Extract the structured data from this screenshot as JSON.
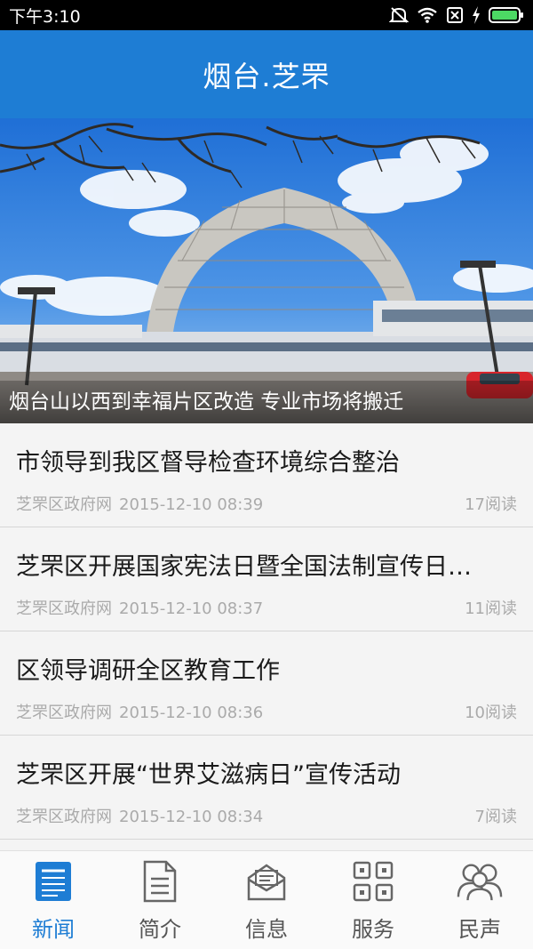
{
  "status_bar": {
    "time": "下午3:10",
    "icons": [
      "mute-icon",
      "wifi-icon",
      "sim-off-icon",
      "charging-icon",
      "battery-icon"
    ]
  },
  "header": {
    "title": "烟台.芝罘"
  },
  "hero": {
    "caption": "烟台山以西到幸福片区改造 专业市场将搬迁"
  },
  "news": [
    {
      "title": "市领导到我区督导检查环境综合整治",
      "source": "芝罘区政府网",
      "time": "2015-12-10 08:39",
      "reads": "17阅读"
    },
    {
      "title": "芝罘区开展国家宪法日暨全国法制宣传日…",
      "source": "芝罘区政府网",
      "time": "2015-12-10 08:37",
      "reads": "11阅读"
    },
    {
      "title": "区领导调研全区教育工作",
      "source": "芝罘区政府网",
      "time": "2015-12-10 08:36",
      "reads": "10阅读"
    },
    {
      "title": "芝罘区开展“世界艾滋病日”宣传活动",
      "source": "芝罘区政府网",
      "time": "2015-12-10 08:34",
      "reads": "7阅读"
    }
  ],
  "bottom_nav": [
    {
      "label": "新闻",
      "icon": "news-icon",
      "active": true
    },
    {
      "label": "简介",
      "icon": "document-icon",
      "active": false
    },
    {
      "label": "信息",
      "icon": "mail-icon",
      "active": false
    },
    {
      "label": "服务",
      "icon": "grid-icon",
      "active": false
    },
    {
      "label": "民声",
      "icon": "people-icon",
      "active": false
    }
  ],
  "colors": {
    "primary": "#1e7dd4",
    "status_bar": "#000000",
    "battery": "#4cd964"
  }
}
